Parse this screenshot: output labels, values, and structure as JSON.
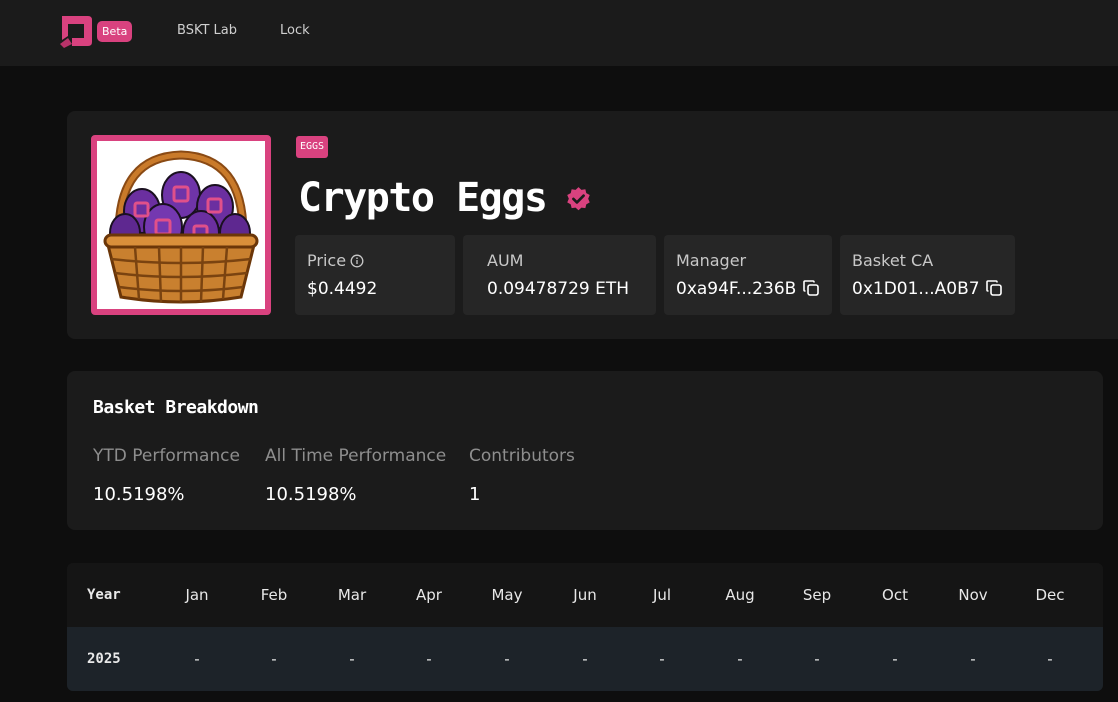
{
  "nav": {
    "badge": "Beta",
    "links": [
      "BSKT Lab",
      "Lock"
    ]
  },
  "colors": {
    "accent": "#d9427f",
    "background": "#0e0e0e",
    "card": "#1b1b1b",
    "stat_box": "#262626"
  },
  "basket": {
    "tag": "EGGS",
    "name": "Crypto Eggs",
    "image_icon": "egg-basket-image",
    "verified_icon": "verified-badge-icon",
    "stats": {
      "price": {
        "label": "Price",
        "value": "$0.4492",
        "icon": "info-icon"
      },
      "aum": {
        "label": "AUM",
        "value": "0.09478729 ETH"
      },
      "manager": {
        "label": "Manager",
        "value": "0xa94F...236B",
        "icon": "copy-icon"
      },
      "basket_ca": {
        "label": "Basket CA",
        "value": "0x1D01...A0B7",
        "icon": "copy-icon"
      }
    }
  },
  "breakdown": {
    "title": "Basket Breakdown",
    "metrics": [
      {
        "label": "YTD Performance",
        "value": "10.5198%"
      },
      {
        "label": "All Time Performance",
        "value": "10.5198%"
      },
      {
        "label": "Contributors",
        "value": "1"
      }
    ]
  },
  "monthly_table": {
    "year_header": "Year",
    "months": [
      "Jan",
      "Feb",
      "Mar",
      "Apr",
      "May",
      "Jun",
      "Jul",
      "Aug",
      "Sep",
      "Oct",
      "Nov",
      "Dec"
    ],
    "rows": [
      {
        "year": "2025",
        "values": [
          "-",
          "-",
          "-",
          "-",
          "-",
          "-",
          "-",
          "-",
          "-",
          "-",
          "-",
          "-"
        ]
      }
    ]
  }
}
